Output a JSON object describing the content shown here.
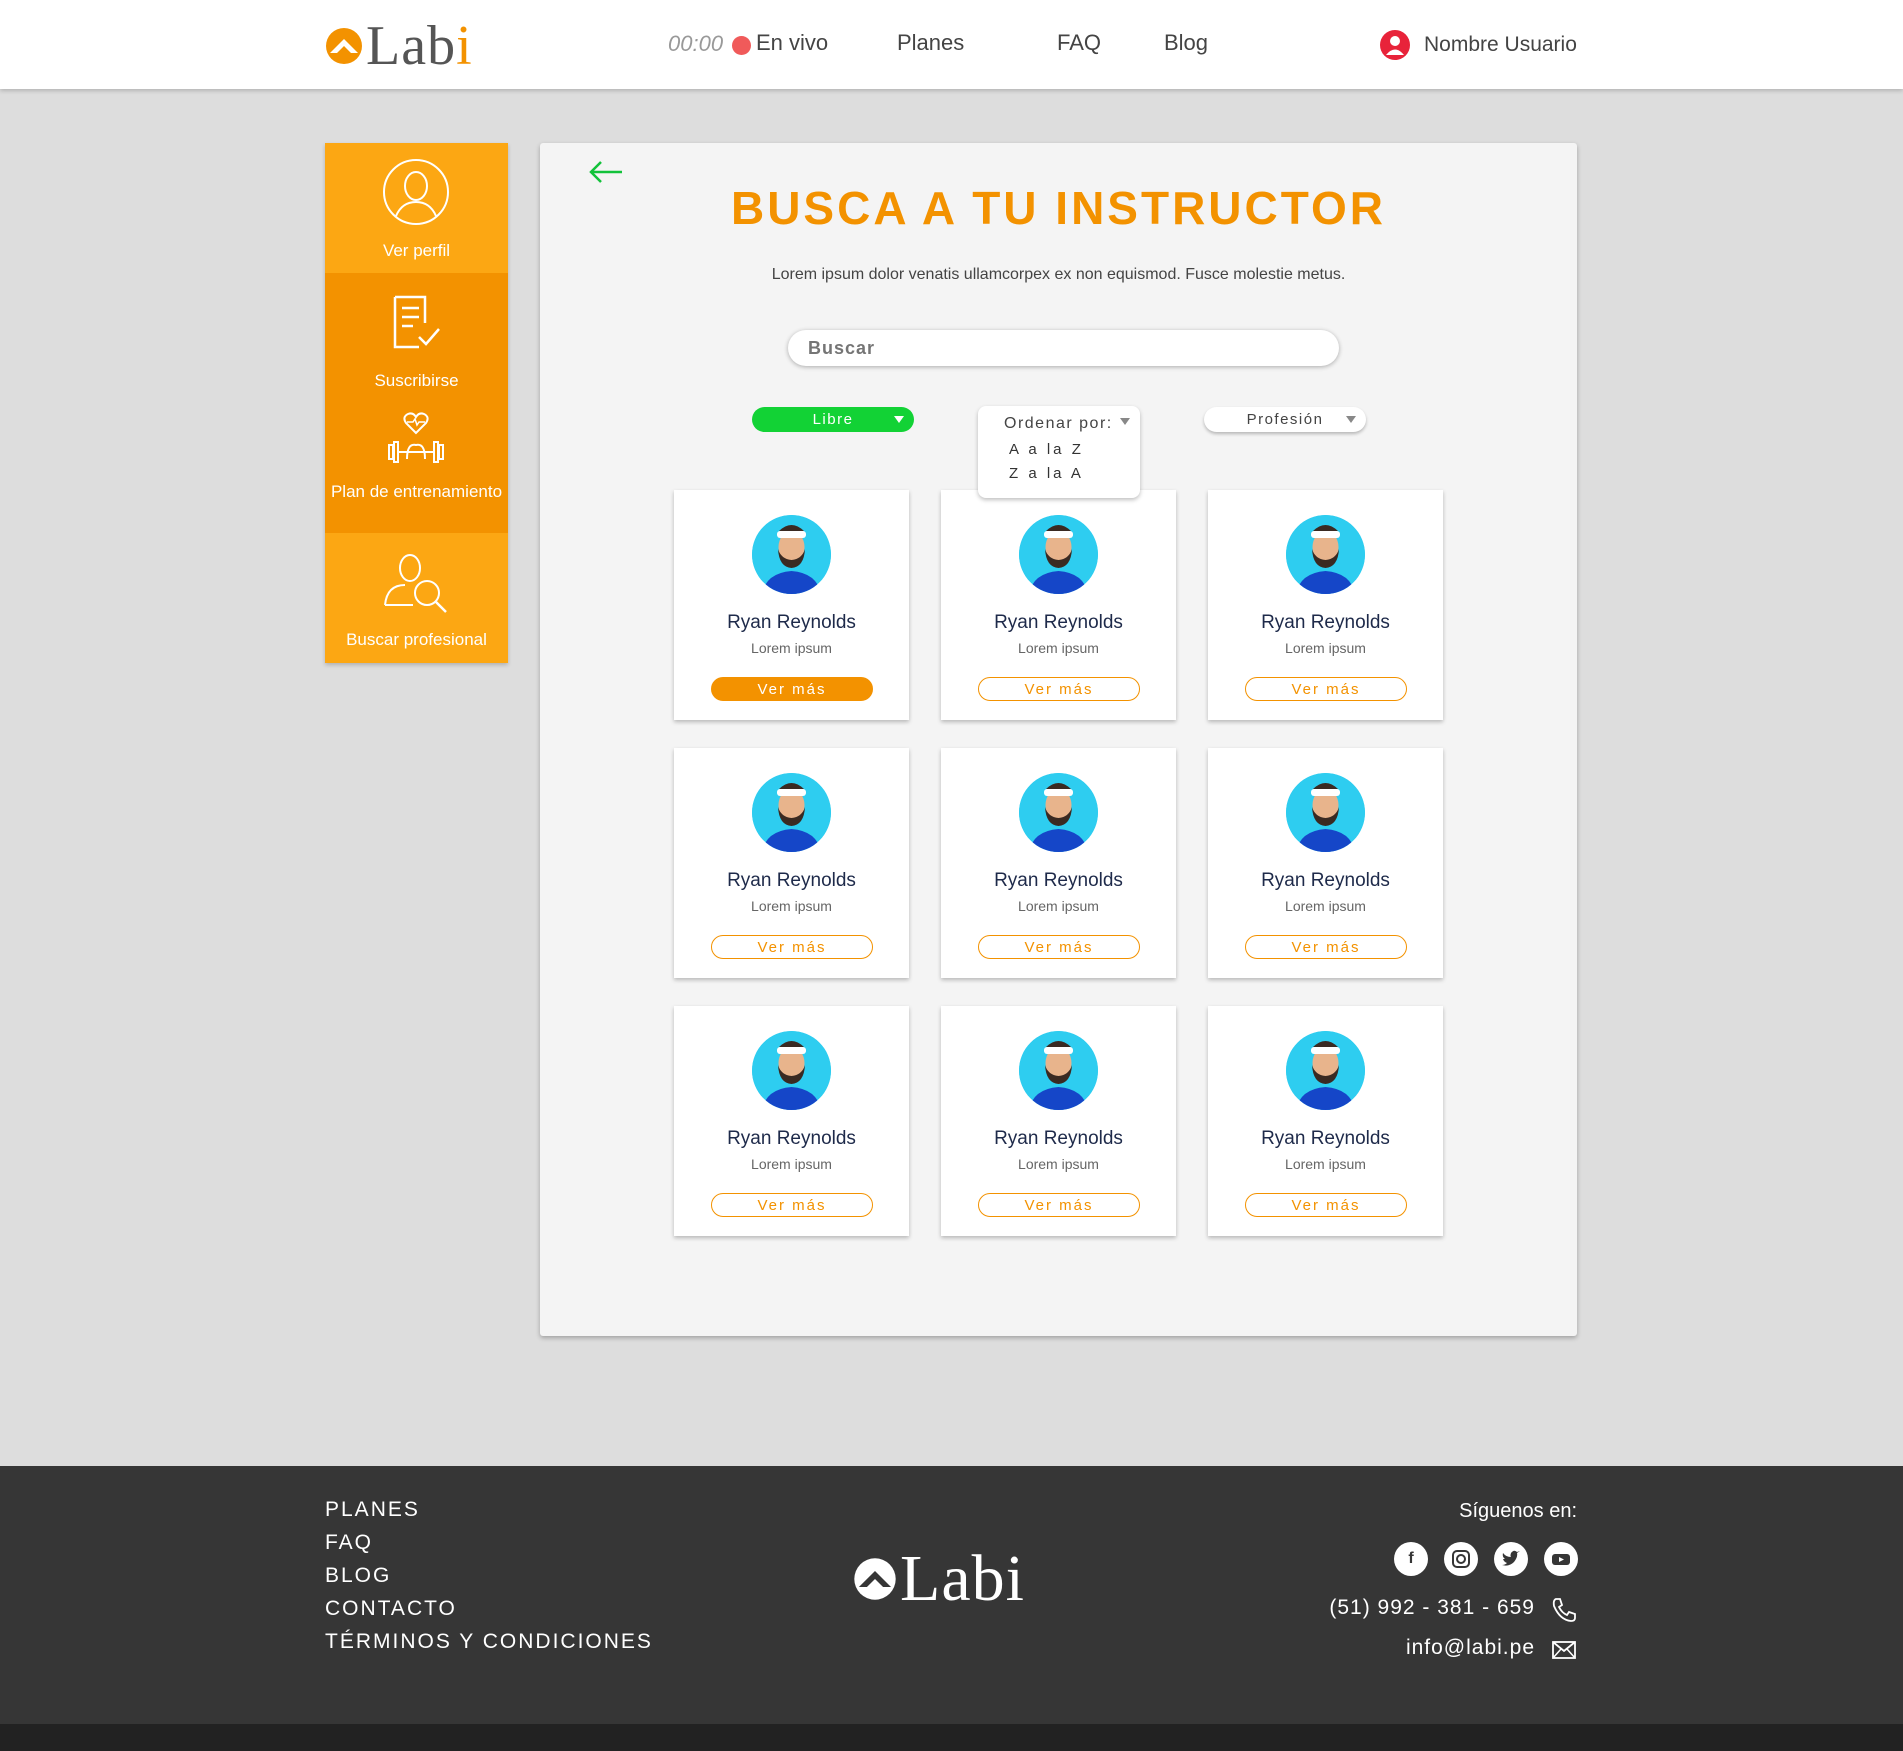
{
  "header": {
    "logo_text": "Lab",
    "logo_i": "i",
    "timer": "00:00",
    "live_label": "En vivo",
    "nav": [
      "Planes",
      "FAQ",
      "Blog"
    ],
    "user_name": "Nombre Usuario"
  },
  "sidebar": {
    "items": [
      {
        "label": "Ver perfil",
        "icon": "user-outline-icon"
      },
      {
        "label": "Suscribirse",
        "icon": "document-check-icon"
      },
      {
        "label": "Plan de entrenamiento",
        "icon": "dumbbell-heart-icon"
      },
      {
        "label": "Buscar profesional",
        "icon": "user-search-icon"
      }
    ]
  },
  "main": {
    "title": "BUSCA A TU INSTRUCTOR",
    "subtitle": "Lorem ipsum dolor venatis ullamcorpex ex non equismod. Fusce molestie metus.",
    "search_placeholder": "Buscar",
    "filters": {
      "status": "Libre",
      "sort_label": "Ordenar por:",
      "sort_options": [
        "A a la Z",
        "Z a la A"
      ],
      "profession": "Profesión"
    },
    "cards": [
      {
        "name": "Ryan Reynolds",
        "role": "Lorem ipsum",
        "button": "Ver más"
      },
      {
        "name": "Ryan Reynolds",
        "role": "Lorem ipsum",
        "button": "Ver más"
      },
      {
        "name": "Ryan Reynolds",
        "role": "Lorem ipsum",
        "button": "Ver más"
      },
      {
        "name": "Ryan Reynolds",
        "role": "Lorem ipsum",
        "button": "Ver más"
      },
      {
        "name": "Ryan Reynolds",
        "role": "Lorem ipsum",
        "button": "Ver más"
      },
      {
        "name": "Ryan Reynolds",
        "role": "Lorem ipsum",
        "button": "Ver más"
      },
      {
        "name": "Ryan Reynolds",
        "role": "Lorem ipsum",
        "button": "Ver más"
      },
      {
        "name": "Ryan Reynolds",
        "role": "Lorem ipsum",
        "button": "Ver más"
      },
      {
        "name": "Ryan Reynolds",
        "role": "Lorem ipsum",
        "button": "Ver más"
      }
    ]
  },
  "footer": {
    "links": [
      "PLANES",
      "FAQ",
      "BLOG",
      "CONTACTO",
      "TÉRMINOS Y CONDICIONES"
    ],
    "logo_text": "Labi",
    "follow_label": "Síguenos en:",
    "social": [
      "facebook-icon",
      "instagram-icon",
      "twitter-icon",
      "youtube-icon"
    ],
    "phone": "(51) 992 - 381 - 659",
    "email": "info@labi.pe"
  },
  "colors": {
    "accent": "#f39200",
    "accent_light": "#fca713",
    "live": "#f05a5a",
    "green": "#12d235",
    "footer": "#363636"
  }
}
